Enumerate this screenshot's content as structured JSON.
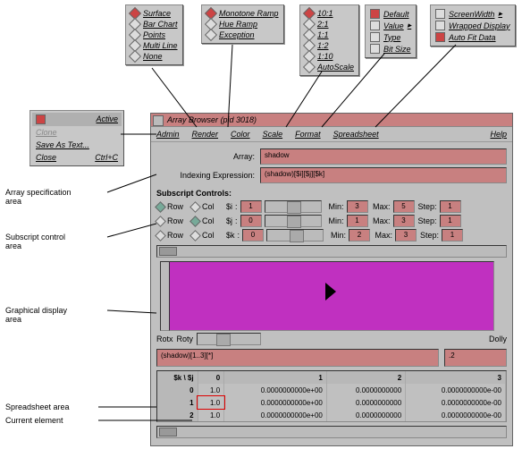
{
  "popups": {
    "render": [
      "Surface",
      "Bar Chart",
      "Points",
      "Multi Line",
      "None"
    ],
    "color": [
      "Monotone Ramp",
      "Hue Ramp",
      "Exception"
    ],
    "scale": [
      "10:1",
      "2:1",
      "1:1",
      "1:2",
      "1:10",
      "AutoScale"
    ],
    "format": [
      "Default",
      "Value",
      "Type",
      "Bit Size"
    ],
    "spread": [
      "ScreenWidth",
      "Wrapped Display",
      "Auto Fit Data"
    ]
  },
  "ctx": {
    "active": "Active",
    "clone": "Clone",
    "save": "Save As Text...",
    "close": "Close",
    "close_acc": "Ctrl+C"
  },
  "win": {
    "title": "Array Browser (pid 3018)",
    "menus": [
      "Admin",
      "Render",
      "Color",
      "Scale",
      "Format",
      "Spreadsheet"
    ],
    "help": "Help",
    "array_lbl": "Array:",
    "array_val": "shadow",
    "idx_lbl": "Indexing Expression:",
    "idx_val": "(shadow)[$i][$j][$k]",
    "sub_lbl": "Subscript Controls:",
    "subs": [
      {
        "name": "$i",
        "cur": "1",
        "min": "3",
        "max": "5",
        "step": "1"
      },
      {
        "name": "$j",
        "cur": "0",
        "min": "1",
        "max": "3",
        "step": "1"
      },
      {
        "name": "$k",
        "cur": "0",
        "min": "2",
        "max": "3",
        "step": "1"
      }
    ],
    "row_lbl": "Row",
    "col_lbl": "Col",
    "rotx": "Rotx",
    "roty": "Roty",
    "dolly": "Dolly",
    "expr_l": "(shadow)[1..3][*]",
    "expr_r": ".2",
    "sheet_hdr": "$k \\ $j",
    "cols": [
      "0",
      "1",
      "2",
      "3"
    ],
    "rows": [
      {
        "h": "0",
        "c": [
          "1.0",
          "0.0000000000e+00",
          "0.0000000000",
          "0.0000000000e-00"
        ]
      },
      {
        "h": "1",
        "c": [
          "1.0",
          "0.0000000000e+00",
          "0.0000000000",
          "0.0000000000e-00"
        ]
      },
      {
        "h": "2",
        "c": [
          "1.0",
          "0.0000000000e+00",
          "0.0000000000",
          "0.0000000000e-00"
        ]
      }
    ]
  },
  "annot": {
    "spec": "Array specification\narea",
    "sub": "Subscript control\narea",
    "gfx": "Graphical display\narea",
    "sheet": "Spreadsheet area",
    "cur": "Current element"
  },
  "chart_data": {
    "type": "area",
    "title": "",
    "note": "Magenta 3D surface/area render of array slice; single dark peak near center",
    "x": [
      0,
      1,
      2,
      3
    ],
    "values": [
      0,
      0,
      0,
      0
    ]
  }
}
